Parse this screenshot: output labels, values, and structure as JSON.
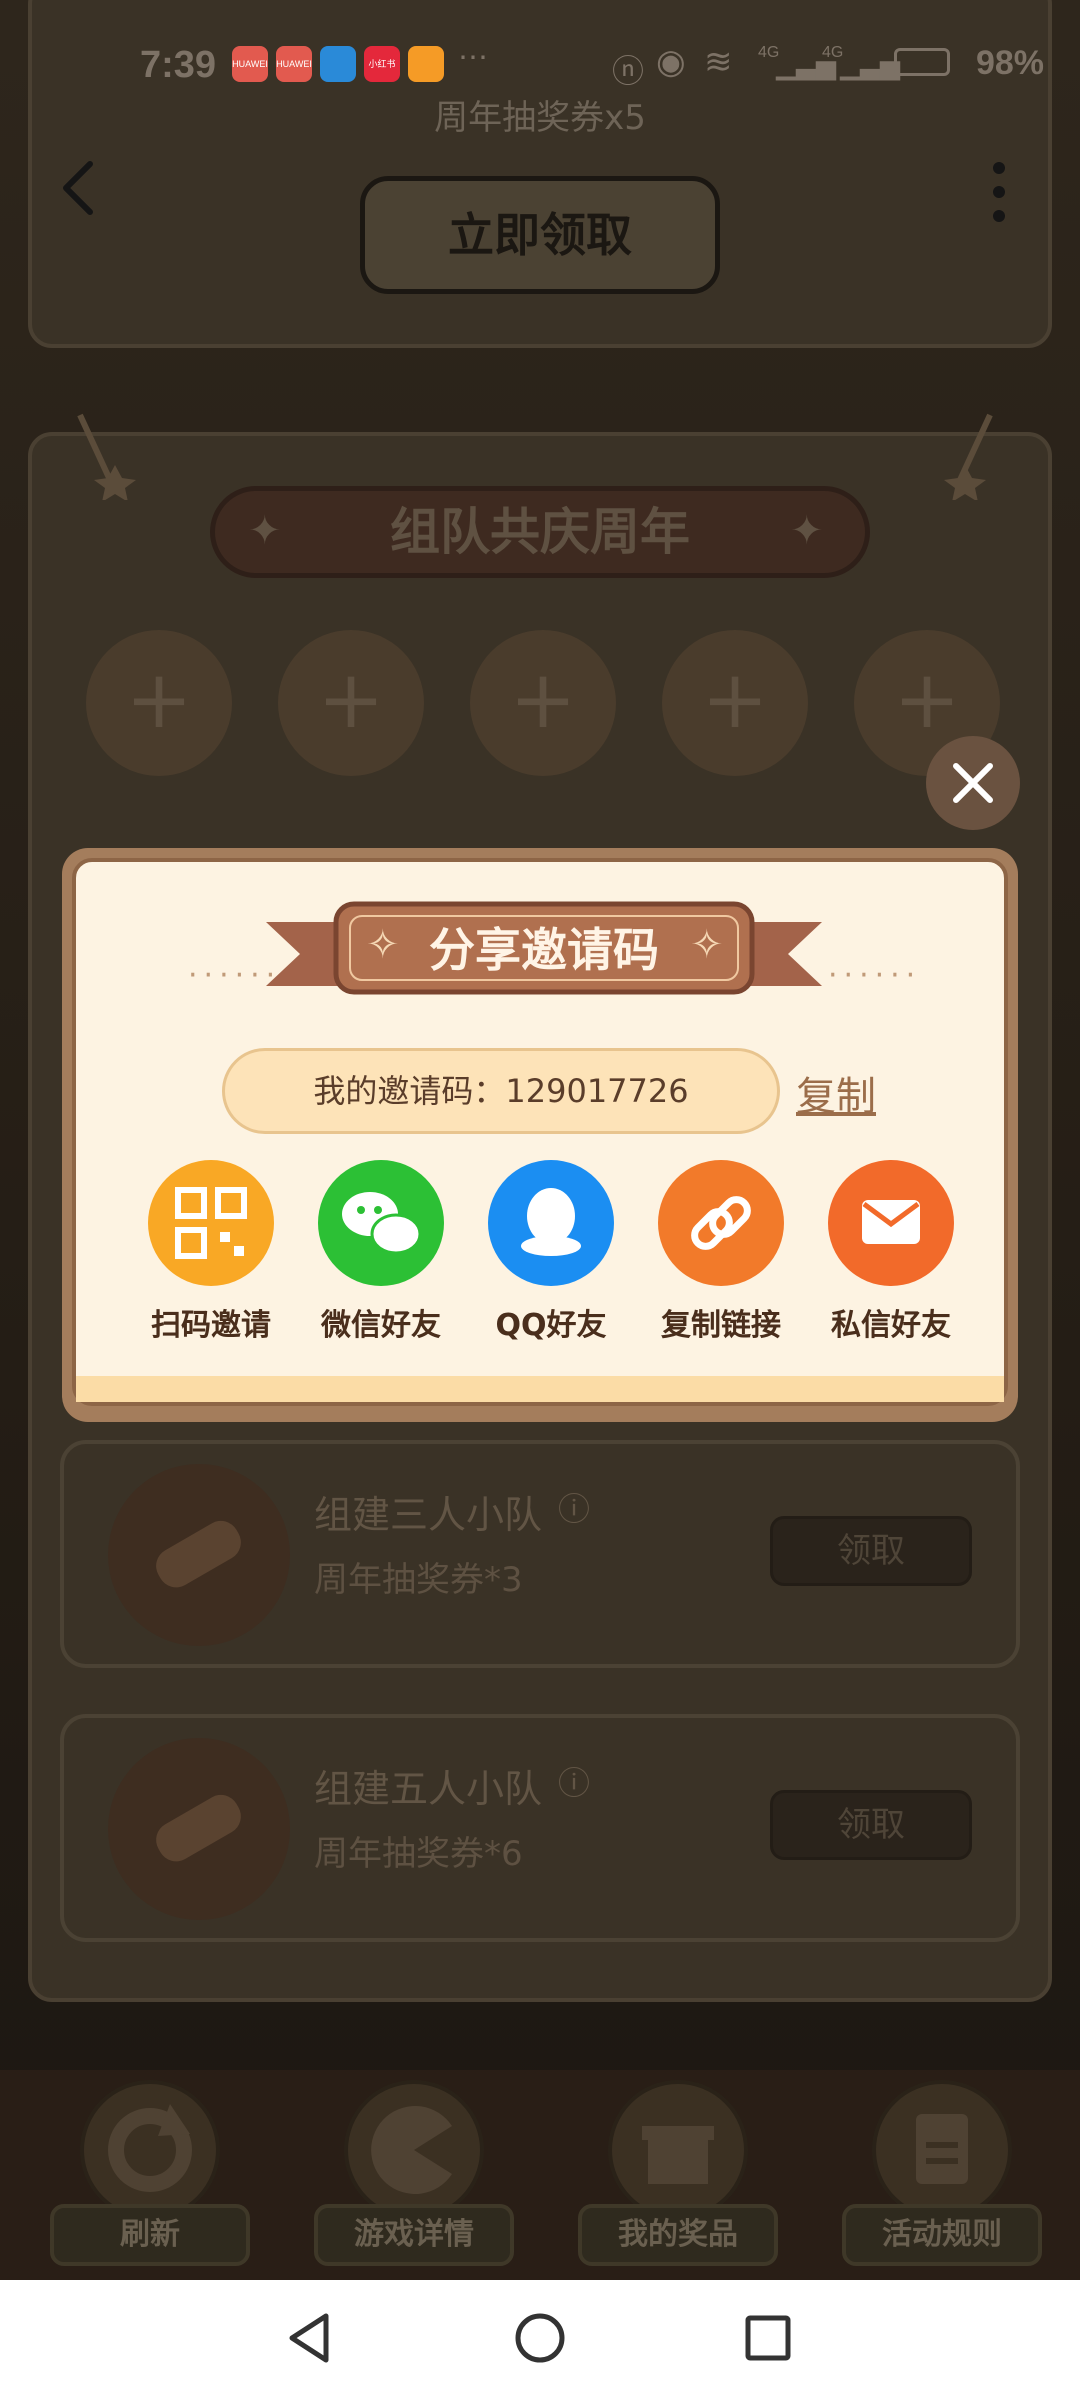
{
  "status_bar": {
    "time": "7:39",
    "battery": "98%",
    "network": "4G",
    "notif_tiny": [
      "HUAWEI",
      "HUAWEI",
      "",
      "小红书",
      ""
    ]
  },
  "top_card": {
    "reward_text": "周年抽奖券x5",
    "claim_button": "立即领取"
  },
  "team_section": {
    "banner_title": "组队共庆周年",
    "slot_symbol": "+",
    "slot_count": 5,
    "tasks": [
      {
        "title": "组建三人小队",
        "reward": "周年抽奖券*3",
        "button": "领取"
      },
      {
        "title": "组建五人小队",
        "reward": "周年抽奖券*6",
        "button": "领取"
      }
    ]
  },
  "bottom_nav": [
    {
      "label": "刷新",
      "icon": "refresh-icon"
    },
    {
      "label": "游戏详情",
      "icon": "game-icon"
    },
    {
      "label": "我的奖品",
      "icon": "gift-icon"
    },
    {
      "label": "活动规则",
      "icon": "rules-icon"
    }
  ],
  "modal": {
    "title": "分享邀请码",
    "invite_code_text": "我的邀请码：129017726",
    "copy_label": "复制",
    "share_options": [
      {
        "label": "扫码邀请",
        "icon": "qr-code-icon",
        "color": "#f9a825"
      },
      {
        "label": "微信好友",
        "icon": "wechat-icon",
        "color": "#2cc035"
      },
      {
        "label": "QQ好友",
        "icon": "qq-icon",
        "color": "#1b8ef2"
      },
      {
        "label": "复制链接",
        "icon": "link-icon",
        "color": "#f27a2a"
      },
      {
        "label": "私信好友",
        "icon": "mail-icon",
        "color": "#f26a2a"
      }
    ]
  },
  "colors": {
    "modal_background": "#fdf3e2",
    "ribbon": "#a3634a",
    "copy_link": "#9b6d4a"
  }
}
